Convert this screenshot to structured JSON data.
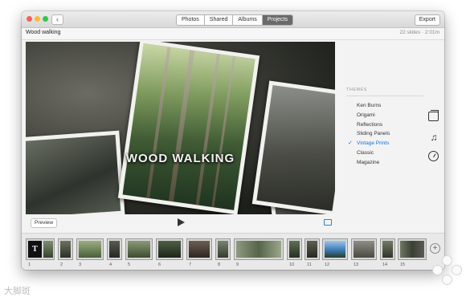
{
  "toolbar": {
    "tabs": [
      {
        "label": "Photos"
      },
      {
        "label": "Shared"
      },
      {
        "label": "Albums"
      },
      {
        "label": "Projects"
      }
    ],
    "active_tab": "Projects",
    "export_label": "Export",
    "back_icon": "chevron-left-icon"
  },
  "project": {
    "title": "Wood walking",
    "info": "22 slides · 2:01m"
  },
  "viewer": {
    "title_text": "WOOD WALKING"
  },
  "controls": {
    "preview_label": "Preview",
    "play_icon": "play-icon",
    "aspect_icon": "aspect-ratio-icon"
  },
  "themes": {
    "header": "THEMES",
    "items": [
      {
        "label": "Ken Burns",
        "selected": false
      },
      {
        "label": "Origami",
        "selected": false
      },
      {
        "label": "Reflections",
        "selected": false
      },
      {
        "label": "Sliding Panels",
        "selected": false
      },
      {
        "label": "Vintage Prints",
        "selected": true
      },
      {
        "label": "Classic",
        "selected": false
      },
      {
        "label": "Magazine",
        "selected": false
      }
    ],
    "check_glyph": "✓"
  },
  "side_icons": [
    "themes-icon",
    "music-icon",
    "duration-icon"
  ],
  "filmstrip": {
    "title_clip_glyph": "T",
    "clips": [
      {
        "num": "1",
        "kind": "title"
      },
      {
        "num": "2",
        "kind": "photo"
      },
      {
        "num": "3",
        "kind": "photo"
      },
      {
        "num": "4",
        "kind": "photo"
      },
      {
        "num": "5",
        "kind": "photo"
      },
      {
        "num": "6",
        "kind": "photo"
      },
      {
        "num": "7",
        "kind": "photo"
      },
      {
        "num": "8",
        "kind": "photo"
      },
      {
        "num": "9",
        "kind": "photo"
      },
      {
        "num": "10",
        "kind": "photo"
      },
      {
        "num": "11",
        "kind": "photo"
      },
      {
        "num": "12",
        "kind": "photo"
      },
      {
        "num": "13",
        "kind": "photo"
      },
      {
        "num": "14",
        "kind": "photo"
      },
      {
        "num": "15",
        "kind": "photo"
      }
    ],
    "add_glyph": "+"
  },
  "watermark": {
    "text": "大脚斑"
  }
}
